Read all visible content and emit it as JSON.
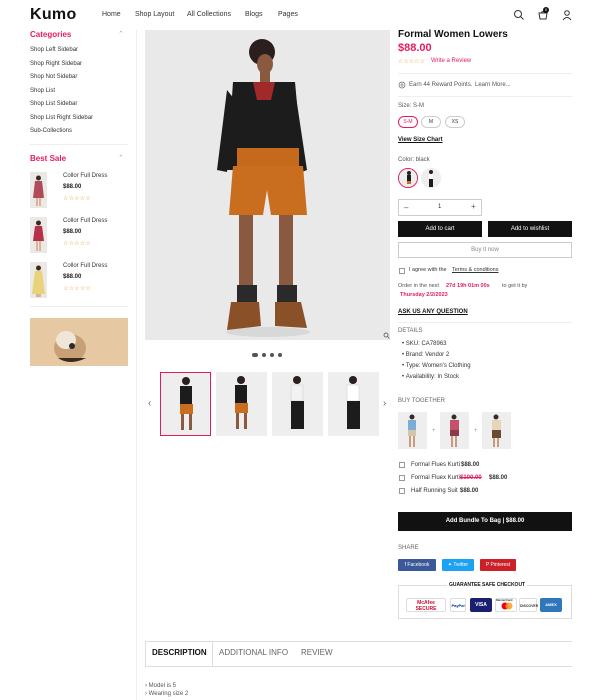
{
  "header": {
    "logo": "Kumo",
    "nav": [
      "Home",
      "Shop Layout",
      "All Collections",
      "Blogs",
      "Pages"
    ],
    "cart_count": "0"
  },
  "sidebar": {
    "categories_title": "Categories",
    "categories": [
      "Shop Left Sidebar",
      "Shop Right Sidebar",
      "Shop Not Sidebar",
      "Shop List",
      "Shop List Sidebar",
      "Shop List Right Sidebar",
      "Sub-Collections"
    ],
    "best_sale_title": "Best Sale",
    "best_sale": [
      {
        "name": "Collor Full Dress",
        "price": "$88.00",
        "stars": "☆☆☆☆☆"
      },
      {
        "name": "Collor Full Dress",
        "price": "$88.00",
        "stars": "☆☆☆☆☆"
      },
      {
        "name": "Collor Full Dress",
        "price": "$88.00",
        "stars": "☆☆☆☆☆"
      }
    ]
  },
  "product": {
    "title": "Formal Women Lowers",
    "price": "$88.00",
    "rating_stars": "☆☆☆☆☆",
    "write_review": "Write a Review",
    "reward_text": "Earn 44 Reward Points.",
    "learn_more": "Learn More...",
    "size_label": "Size: S-M",
    "sizes": [
      "S-M",
      "M",
      "XS"
    ],
    "size_chart": "View Size Chart",
    "color_label": "Color: black",
    "quantity": "1",
    "qty_minus": "–",
    "qty_plus": "+",
    "add_to_cart": "Add to cart",
    "add_to_wishlist": "Add to wishlist",
    "buy_now": "Buy it now",
    "agree_prefix": "I agree with the",
    "terms": "Terms & conditions",
    "order_prefix": "Order in the next",
    "countdown": "27d 19h 01m 00s",
    "order_suffix": "to get it by",
    "delivery_date": "Thursday 2/2/2023",
    "ask_question": "ASK US ANY QUESTION",
    "details_title": "DETAILS",
    "details": [
      {
        "label": "SKU:",
        "value": "CA78963"
      },
      {
        "label": "Brand:",
        "value": "Vendor 2"
      },
      {
        "label": "Type:",
        "value": "Women's Clothing"
      },
      {
        "label": "Availability:",
        "value": "In Stock"
      }
    ],
    "buy_together_title": "BUY TOGETHER",
    "bundle_items": [
      {
        "name": "Formal Flues Kurti",
        "price": "$88.00",
        "old_price": ""
      },
      {
        "name": "Formal Fluex Kurti",
        "price": "$88.00",
        "old_price": "$100.00"
      },
      {
        "name": "Half Running Suit",
        "price": "$88.00",
        "old_price": ""
      }
    ],
    "bundle_button": "Add Bundle To Bag | $88.00",
    "share_title": "SHARE",
    "share": [
      "Facebook",
      "Twitter",
      "Pinterest"
    ],
    "checkout_title": "GUARANTEE SAFE CHECKOUT",
    "payments": [
      "McAfee SECURE",
      "PayPal",
      "VISA",
      "MasterCard",
      "DISCOVER",
      "AMEX"
    ]
  },
  "tabs": [
    "DESCRIPTION",
    "ADDITIONAL INFO",
    "REVIEW"
  ],
  "description": [
    "Model is 5",
    "Wearing size 2"
  ],
  "colors": {
    "accent": "#e31d5d",
    "dark": "#111111"
  }
}
